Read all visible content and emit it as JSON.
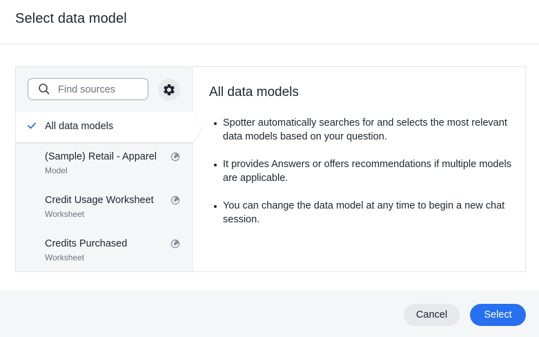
{
  "dialog": {
    "title": "Select data model"
  },
  "sidebar": {
    "search": {
      "placeholder": "Find sources",
      "value": ""
    },
    "icons": {
      "search": "search-icon",
      "settings": "gear-icon"
    },
    "selected": {
      "label": "All data models",
      "icon": "check-icon"
    },
    "items": [
      {
        "name": "(Sample) Retail - Apparel",
        "type": "Model",
        "icon": "eye-icon"
      },
      {
        "name": "Credit Usage Worksheet",
        "type": "Worksheet",
        "icon": "eye-icon"
      },
      {
        "name": "Credits Purchased",
        "type": "Worksheet",
        "icon": "eye-icon"
      }
    ]
  },
  "main": {
    "title": "All data models",
    "bullets": [
      "Spotter automatically searches for and selects the most relevant data models based on your question.",
      "It provides Answers or offers recommendations if multiple models are applicable.",
      "You can change the data model at any time to begin a new chat session."
    ]
  },
  "footer": {
    "cancel_label": "Cancel",
    "select_label": "Select"
  },
  "colors": {
    "accent": "#2770ef",
    "sidebar_bg": "#f5f6f8",
    "text": "#1d232f",
    "muted": "#6b7380"
  }
}
